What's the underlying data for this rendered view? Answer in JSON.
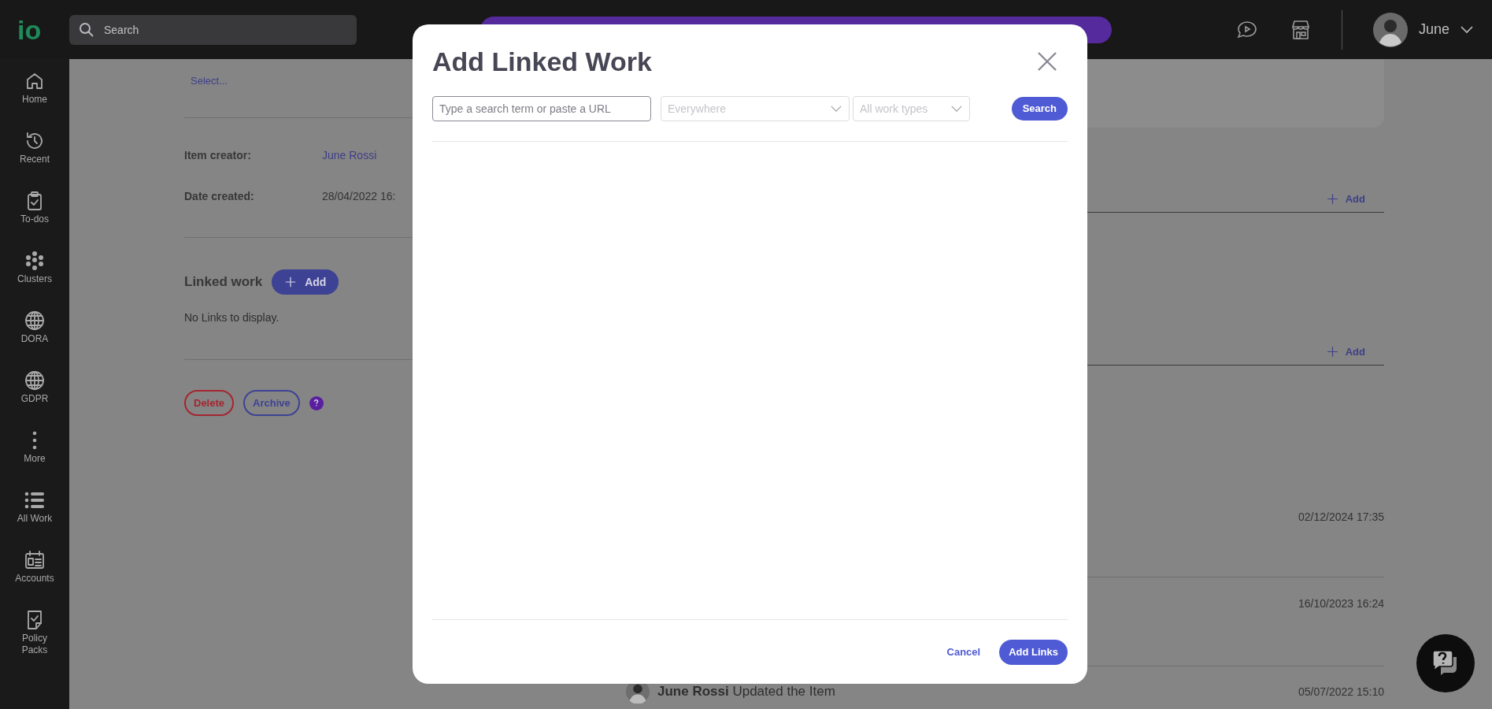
{
  "top_bar": {
    "logo": "io",
    "search": {
      "placeholder": "Search"
    },
    "user": {
      "name": "June"
    }
  },
  "sidebar": {
    "items": [
      {
        "label": "Home",
        "kind": "home"
      },
      {
        "label": "Recent",
        "kind": "recent"
      },
      {
        "label": "To-dos",
        "kind": "todos"
      },
      {
        "label": "Clusters",
        "kind": "clusters"
      },
      {
        "label": "DORA",
        "kind": "globe"
      },
      {
        "label": "GDPR",
        "kind": "globe"
      },
      {
        "label": "More",
        "kind": "more"
      },
      {
        "label": "All Work",
        "kind": "list"
      },
      {
        "label": "Accounts",
        "kind": "accounts"
      },
      {
        "label": "Policy Packs",
        "kind": "policy"
      }
    ]
  },
  "page": {
    "select_link": "Select...",
    "fields": [
      {
        "label": "Item creator:",
        "value": "June Rossi",
        "kind": "link"
      },
      {
        "label": "Date created:",
        "value": "28/04/2022 16:",
        "kind": "text"
      }
    ],
    "linked_work": {
      "title": "Linked work",
      "add_button": "Add",
      "empty": "No Links to display."
    },
    "actions": [
      {
        "label": "Delete",
        "kind": "danger"
      },
      {
        "label": "Archive",
        "kind": "secondary"
      }
    ],
    "section_add_buttons": [
      "Add",
      "Add"
    ],
    "activity": [
      {
        "time": "02/12/2024 17:35"
      },
      {
        "time": "16/10/2023 16:24"
      },
      {
        "time": "05/07/2022 15:10",
        "user": "June Rossi",
        "action": "Updated the Item"
      }
    ]
  },
  "modal": {
    "title": "Add Linked Work",
    "search": {
      "placeholder": "Type a search term or paste a URL"
    },
    "filters": [
      {
        "placeholder": "Everywhere"
      },
      {
        "placeholder": "All work types"
      }
    ],
    "search_button": "Search",
    "cancel": "Cancel",
    "confirm": "Add Links"
  }
}
